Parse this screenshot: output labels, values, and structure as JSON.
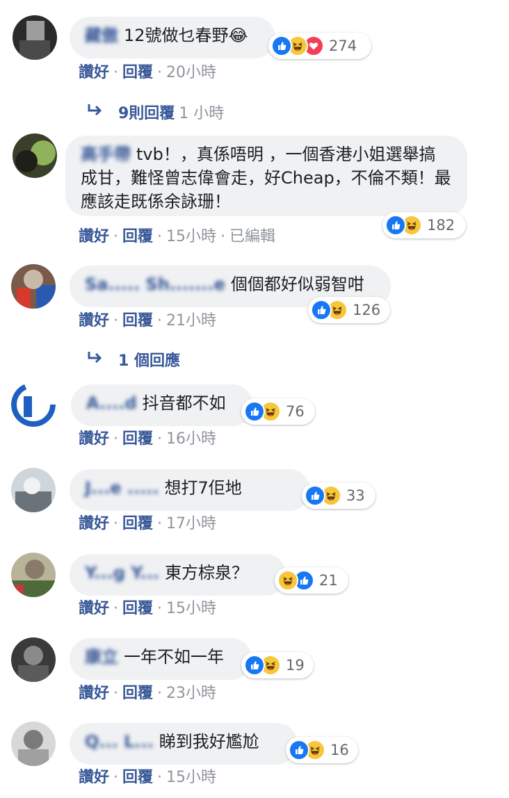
{
  "comments": [
    {
      "name": "藏傲",
      "text": "12號做乜春野😂",
      "reactions": [
        "like",
        "haha",
        "love"
      ],
      "count": "274",
      "like": "讚好",
      "reply": "回覆",
      "time": "20小時",
      "edited": "",
      "replies_label": "9則回覆",
      "replies_time": "1 小時"
    },
    {
      "name": "高手帶",
      "text": "tvb！，真係唔明 ，一個香港小姐選舉搞成甘，難怪曾志偉會走，好Cheap，不倫不類！最應該走既係余詠珊！",
      "reactions": [
        "like",
        "haha"
      ],
      "count": "182",
      "like": "讚好",
      "reply": "回覆",
      "time": "15小時",
      "edited": "已編輯"
    },
    {
      "name": "Sa..... Sh.......e",
      "text": "個個都好似弱智咁",
      "reactions": [
        "like",
        "haha"
      ],
      "count": "126",
      "like": "讚好",
      "reply": "回覆",
      "time": "21小時",
      "replies_label": "1 個回應"
    },
    {
      "name": "A....d",
      "text": "抖音都不如",
      "reactions": [
        "like",
        "haha"
      ],
      "count": "76",
      "like": "讚好",
      "reply": "回覆",
      "time": "16小時"
    },
    {
      "name": "J...e .....",
      "text": "想打7佢地",
      "reactions": [
        "like",
        "haha"
      ],
      "count": "33",
      "like": "讚好",
      "reply": "回覆",
      "time": "17小時"
    },
    {
      "name": "Y...g Y...",
      "text": "東方棕泉？",
      "reactions": [
        "haha",
        "like"
      ],
      "count": "21",
      "like": "讚好",
      "reply": "回覆",
      "time": "15小時"
    },
    {
      "name": "康立",
      "text": "一年不如一年",
      "reactions": [
        "like",
        "haha"
      ],
      "count": "19",
      "like": "讚好",
      "reply": "回覆",
      "time": "23小時"
    },
    {
      "name": "Q... L...",
      "text": "睇到我好尷尬",
      "reactions": [
        "like",
        "haha"
      ],
      "count": "16",
      "like": "讚好",
      "reply": "回覆",
      "time": "15小時"
    }
  ],
  "colors": {
    "link": "#385898",
    "meta": "#90949c",
    "bubble": "#eff1f3",
    "like": "#1877f2",
    "haha": "#f7c63b",
    "love": "#f33e58"
  }
}
